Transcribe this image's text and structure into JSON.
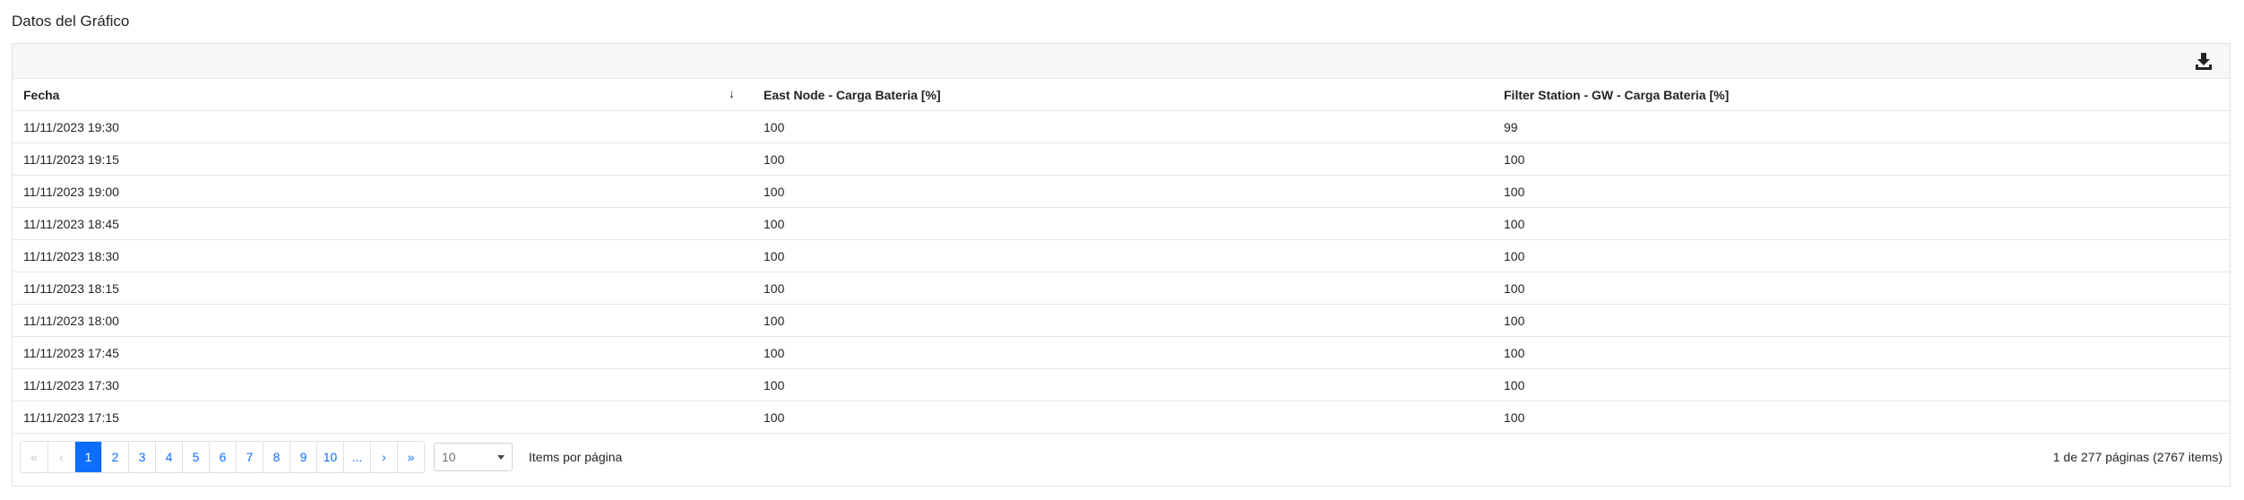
{
  "title": "Datos del Gráfico",
  "columns": [
    "Fecha",
    "East Node - Carga Bateria [%]",
    "Filter Station - GW - Carga Bateria [%]"
  ],
  "rows": [
    [
      "11/11/2023 19:30",
      "100",
      "99"
    ],
    [
      "11/11/2023 19:15",
      "100",
      "100"
    ],
    [
      "11/11/2023 19:00",
      "100",
      "100"
    ],
    [
      "11/11/2023 18:45",
      "100",
      "100"
    ],
    [
      "11/11/2023 18:30",
      "100",
      "100"
    ],
    [
      "11/11/2023 18:15",
      "100",
      "100"
    ],
    [
      "11/11/2023 18:00",
      "100",
      "100"
    ],
    [
      "11/11/2023 17:45",
      "100",
      "100"
    ],
    [
      "11/11/2023 17:30",
      "100",
      "100"
    ],
    [
      "11/11/2023 17:15",
      "100",
      "100"
    ]
  ],
  "pager": {
    "first": "«",
    "prev": "‹",
    "pages": [
      "1",
      "2",
      "3",
      "4",
      "5",
      "6",
      "7",
      "8",
      "9",
      "10",
      "..."
    ],
    "next": "›",
    "last": "»",
    "active_page": "1"
  },
  "page_size": "10",
  "items_per_page_label": "Items por página",
  "page_info": "1 de 277 páginas (2767 items)",
  "icons": {
    "export": "download-icon",
    "sort": "arrow-down-icon"
  },
  "colors": {
    "accent": "#0d6efd"
  }
}
